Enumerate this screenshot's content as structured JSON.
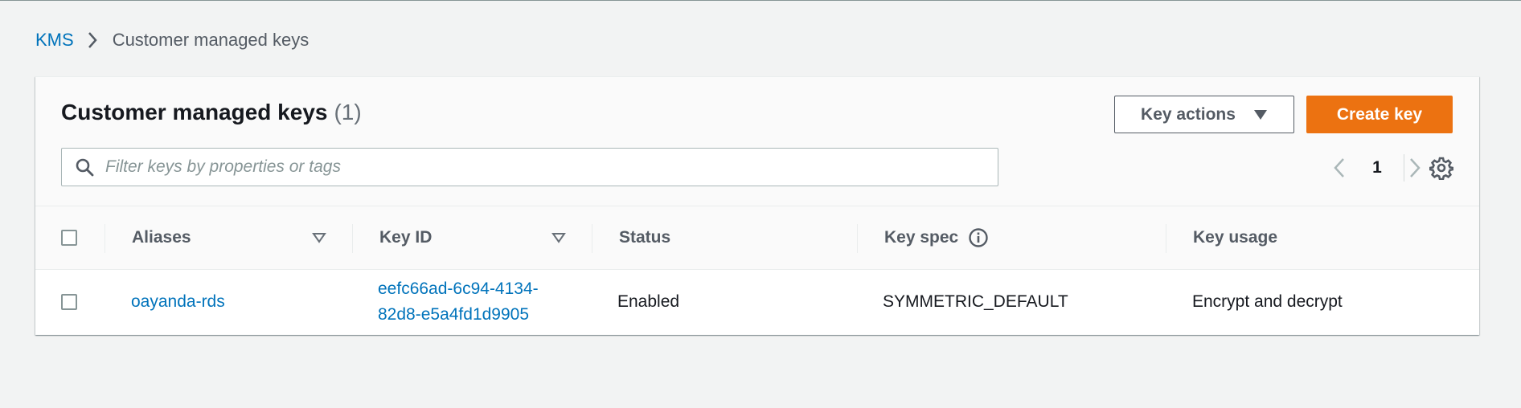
{
  "breadcrumb": {
    "root": "KMS",
    "current": "Customer managed keys"
  },
  "panel": {
    "title": "Customer managed keys",
    "count": "(1)",
    "key_actions_label": "Key actions",
    "create_key_label": "Create key",
    "filter_placeholder": "Filter keys by properties or tags",
    "page_number": "1"
  },
  "table": {
    "columns": {
      "aliases": "Aliases",
      "key_id": "Key ID",
      "status": "Status",
      "key_spec": "Key spec",
      "key_usage": "Key usage"
    },
    "rows": [
      {
        "alias": "oayanda-rds",
        "key_id_line1": "eefc66ad-6c94-4134-",
        "key_id_line2": "82d8-e5a4fd1d9905",
        "status": "Enabled",
        "key_spec": "SYMMETRIC_DEFAULT",
        "key_usage": "Encrypt and decrypt"
      }
    ]
  },
  "icons": {
    "breadcrumb_separator": "chevron-right-icon",
    "key_actions_caret": "caret-down-icon",
    "filter": "search-icon",
    "pager_prev": "chevron-left-icon",
    "pager_next": "chevron-right-icon",
    "settings": "gear-icon",
    "sort": "sort-icon",
    "info": "info-icon"
  },
  "colors": {
    "link": "#0073bb",
    "primary_button": "#ec7211",
    "background": "#f2f3f3"
  }
}
